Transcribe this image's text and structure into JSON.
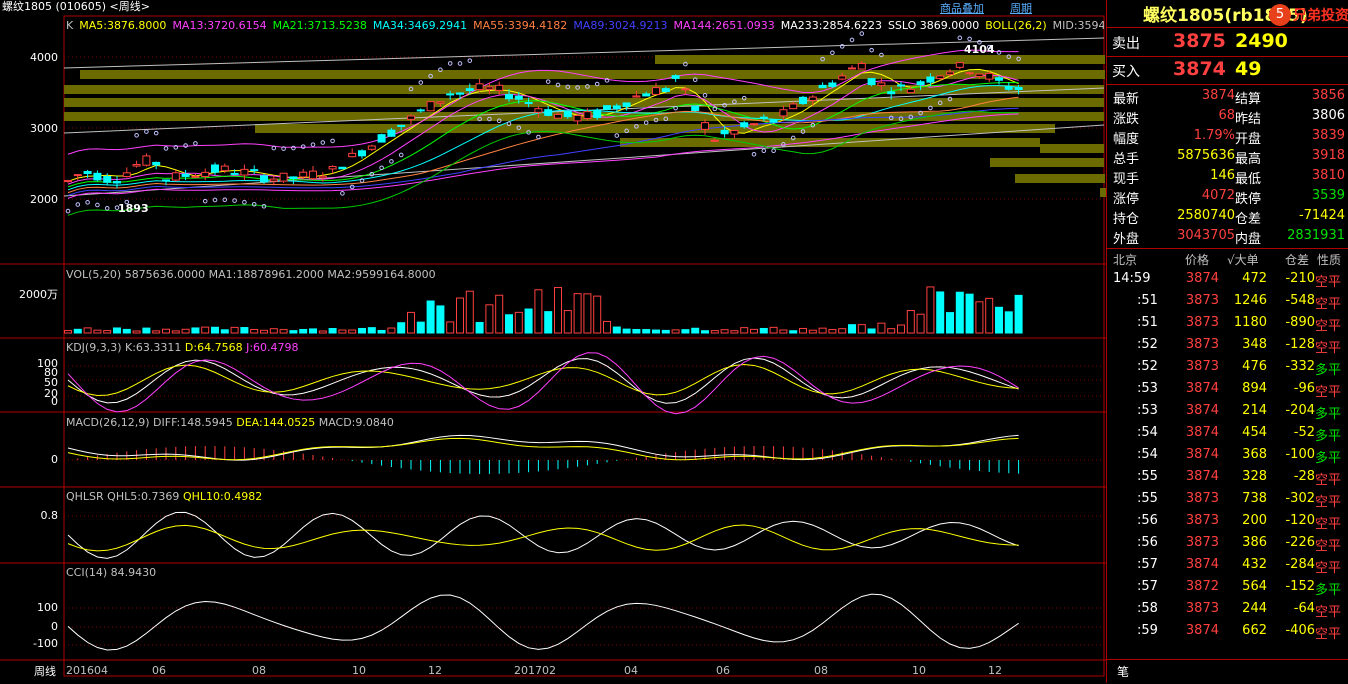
{
  "header": {
    "title": "螺纹1805 (010605) <周线>",
    "menu": [
      "商品叠加",
      "周期"
    ],
    "ma": [
      "K",
      "MA5:3876.8000",
      "MA13:3720.6154",
      "MA21:3713.5238",
      "MA34:3469.2941",
      "MA55:3394.4182",
      "MA89:3024.9213",
      "MA144:2651.0933",
      "MA233:2854.6223",
      "SSLO 3869.0000",
      "BOLL(26,2)",
      "MID:3594"
    ],
    "ma_colors": [
      "#c0c0c0",
      "#ffff00",
      "#ff40ff",
      "#00ff00",
      "#00ffff",
      "#ff8040",
      "#4040ff",
      "#ff40ff",
      "#ffffff",
      "#ffffff",
      "#ffff00"
    ]
  },
  "price_axis": [
    "4000",
    "3000",
    "2000"
  ],
  "annotations": {
    "high": "4104",
    "low": "1893"
  },
  "panels": {
    "vol": {
      "label": "VOL(5,20) 5875636.0000 MA1:18878961.2000 MA2:9599164.8000",
      "axis": "2000万"
    },
    "kdj": {
      "label_prefix": "KDJ(9,3,3) K:63.3311",
      "d": "D:64.7568",
      "j": "J:60.4798",
      "axis": [
        "100",
        "80",
        "50",
        "20",
        "0"
      ]
    },
    "macd": {
      "label_prefix": "MACD(26,12,9) DIFF:148.5945",
      "dea": "DEA:144.0525",
      "macd": "MACD:9.0840",
      "axis": "0"
    },
    "qhlsr": {
      "label_prefix": "QHLSR QHL5:0.7369",
      "qhl10": "QHL10:0.4982",
      "axis": "0.8"
    },
    "cci": {
      "label": "CCI(14) 84.9430",
      "axis": [
        "100",
        "0",
        "-100"
      ]
    }
  },
  "x_axis": {
    "label": "周线",
    "ticks": [
      "201604",
      "06",
      "08",
      "10",
      "12",
      "201702",
      "04",
      "06",
      "08",
      "10",
      "12"
    ]
  },
  "side": {
    "title": "螺纹1805(rb1805)",
    "watermark": "兄弟投资",
    "sell": {
      "label": "卖出",
      "price": "3875",
      "vol": "2490"
    },
    "buy": {
      "label": "买入",
      "price": "3874",
      "vol": "49"
    },
    "stats": [
      {
        "l1": "最新",
        "v1": "3874",
        "c1": "red",
        "l2": "结算",
        "v2": "3856",
        "c2": "red"
      },
      {
        "l1": "涨跌",
        "v1": "68",
        "c1": "red",
        "l2": "昨结",
        "v2": "3806",
        "c2": "wht"
      },
      {
        "l1": "幅度",
        "v1": "1.79%",
        "c1": "red",
        "l2": "开盘",
        "v2": "3839",
        "c2": "red"
      },
      {
        "l1": "总手",
        "v1": "5875636",
        "c1": "yel",
        "l2": "最高",
        "v2": "3918",
        "c2": "red"
      },
      {
        "l1": "现手",
        "v1": "146",
        "c1": "yel",
        "l2": "最低",
        "v2": "3810",
        "c2": "red"
      },
      {
        "l1": "涨停",
        "v1": "4072",
        "c1": "red",
        "l2": "跌停",
        "v2": "3539",
        "c2": "grn"
      },
      {
        "l1": "持仓",
        "v1": "2580740",
        "c1": "yel",
        "l2": "仓差",
        "v2": "-71424",
        "c2": "yel"
      },
      {
        "l1": "外盘",
        "v1": "3043705",
        "c1": "red",
        "l2": "内盘",
        "v2": "2831931",
        "c2": "grn"
      }
    ],
    "tick_header": [
      "北京",
      "价格",
      "√大单",
      "仓差",
      "性质"
    ],
    "ticks": [
      {
        "t": "14:59",
        "p": "3874",
        "v": "472",
        "d": "-210",
        "n": "空平",
        "nc": "red"
      },
      {
        "t": ":51",
        "p": "3873",
        "v": "1246",
        "d": "-548",
        "n": "空平",
        "nc": "red"
      },
      {
        "t": ":51",
        "p": "3873",
        "v": "1180",
        "d": "-890",
        "n": "空平",
        "nc": "red"
      },
      {
        "t": ":52",
        "p": "3873",
        "v": "348",
        "d": "-128",
        "n": "空平",
        "nc": "red"
      },
      {
        "t": ":52",
        "p": "3873",
        "v": "476",
        "d": "-332",
        "n": "多平",
        "nc": "grn"
      },
      {
        "t": ":53",
        "p": "3874",
        "v": "894",
        "d": "-96",
        "n": "空平",
        "nc": "red"
      },
      {
        "t": ":53",
        "p": "3874",
        "v": "214",
        "d": "-204",
        "n": "多平",
        "nc": "grn"
      },
      {
        "t": ":54",
        "p": "3874",
        "v": "454",
        "d": "-52",
        "n": "多平",
        "nc": "grn"
      },
      {
        "t": ":54",
        "p": "3874",
        "v": "368",
        "d": "-100",
        "n": "多平",
        "nc": "grn"
      },
      {
        "t": ":55",
        "p": "3874",
        "v": "328",
        "d": "-28",
        "n": "空平",
        "nc": "red"
      },
      {
        "t": ":55",
        "p": "3873",
        "v": "738",
        "d": "-302",
        "n": "空平",
        "nc": "red"
      },
      {
        "t": ":56",
        "p": "3873",
        "v": "200",
        "d": "-120",
        "n": "空平",
        "nc": "red"
      },
      {
        "t": ":56",
        "p": "3873",
        "v": "386",
        "d": "-226",
        "n": "空平",
        "nc": "red"
      },
      {
        "t": ":57",
        "p": "3874",
        "v": "432",
        "d": "-284",
        "n": "空平",
        "nc": "red"
      },
      {
        "t": ":57",
        "p": "3872",
        "v": "564",
        "d": "-152",
        "n": "多平",
        "nc": "grn"
      },
      {
        "t": ":58",
        "p": "3873",
        "v": "244",
        "d": "-64",
        "n": "空平",
        "nc": "red"
      },
      {
        "t": ":59",
        "p": "3874",
        "v": "662",
        "d": "-406",
        "n": "空平",
        "nc": "red"
      }
    ],
    "footer": "笔"
  }
}
